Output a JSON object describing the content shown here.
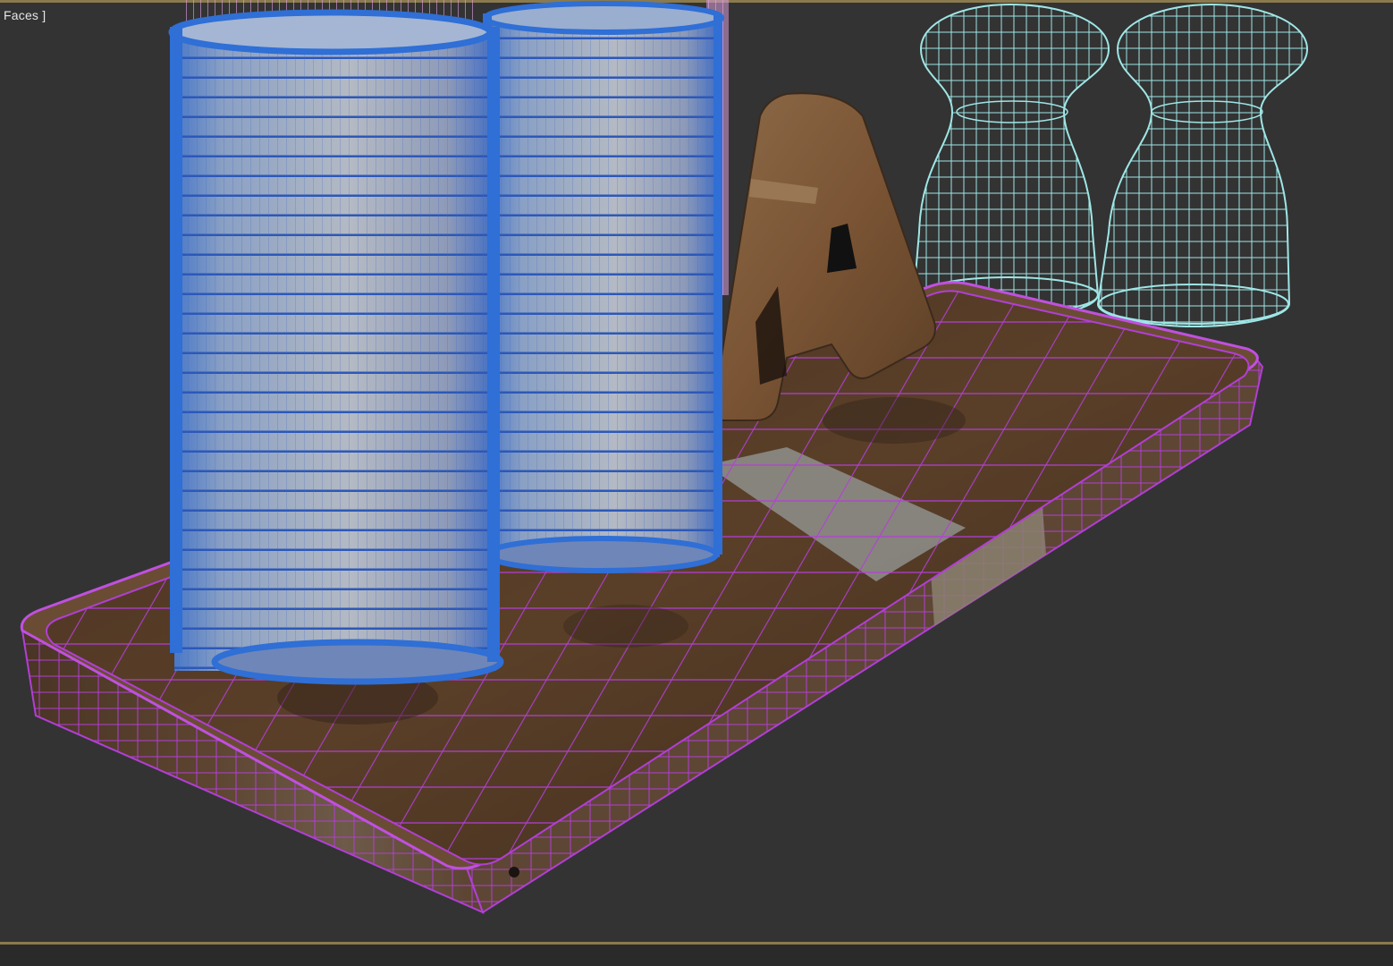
{
  "viewport": {
    "label": "Faces ]",
    "background": "#333333",
    "border_color": "#8a7a4e"
  },
  "scene": {
    "objects": [
      {
        "name": "wooden-tray",
        "wire_color": "#b23ed6"
      },
      {
        "name": "tall-cylinder-left",
        "wire_color": "#2f6fd6"
      },
      {
        "name": "tall-cylinder-right",
        "wire_color": "#2f6fd6"
      },
      {
        "name": "pink-wire-cylinder",
        "wire_color": "#e6a0e6"
      },
      {
        "name": "letter-a-block",
        "wire_color": "#7a5a3a"
      },
      {
        "name": "cyan-wire-vase-left",
        "wire_color": "#9fe6e6"
      },
      {
        "name": "cyan-wire-vase-right",
        "wire_color": "#9fe6e6"
      }
    ]
  }
}
